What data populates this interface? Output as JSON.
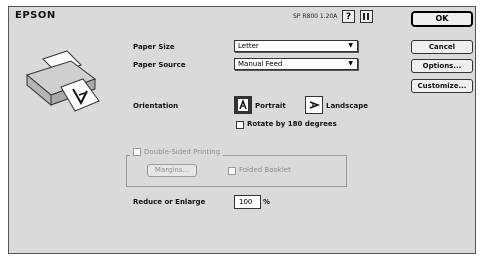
{
  "header": {
    "brand": "EPSON",
    "model": "SP R800 1.20A",
    "help_label": "?"
  },
  "buttons": {
    "ok": "OK",
    "cancel": "Cancel",
    "options": "Options...",
    "customize": "Customize..."
  },
  "paper": {
    "size_label": "Paper Size",
    "size_value": "Letter",
    "source_label": "Paper Source",
    "source_value": "Manual Feed"
  },
  "orientation": {
    "label": "Orientation",
    "portrait": "Portrait",
    "landscape": "Landscape",
    "selected": "Portrait",
    "rotate_label": "Rotate by 180 degrees"
  },
  "double_sided": {
    "label": "Double-Sided Printing",
    "margins_button": "Margins...",
    "folded_booklet": "Folded Booklet"
  },
  "reduce": {
    "label": "Reduce or Enlarge",
    "value": "100",
    "unit": "%"
  },
  "icons": [
    "help-icon",
    "info-icon",
    "printer-illustration-icon",
    "chevron-down-icon",
    "portrait-icon",
    "landscape-icon"
  ]
}
